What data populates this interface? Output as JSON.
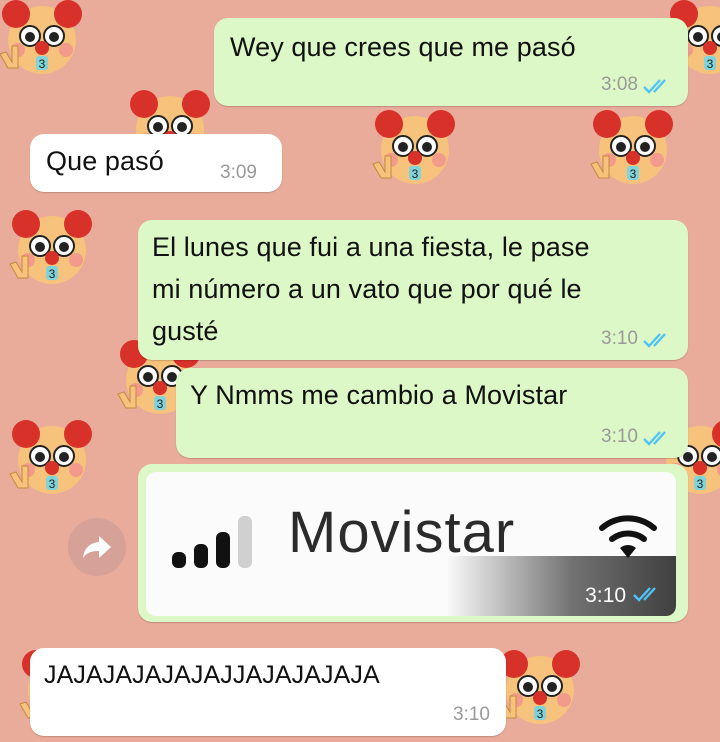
{
  "chat": {
    "wallpaper": {
      "background_color": "#e9ab9a",
      "pattern_icon": "crying-clown-emoji-icon"
    },
    "messages": [
      {
        "direction": "outgoing",
        "text": "Wey que crees que me pasó",
        "time": "3:08",
        "status": "read-double-check"
      },
      {
        "direction": "incoming",
        "text": "Que pasó",
        "time": "3:09"
      },
      {
        "direction": "outgoing",
        "lines": [
          "El lunes que fui a una fiesta, le pase",
          "mi número a un vato que por qué le",
          "gusté"
        ],
        "time": "3:10",
        "status": "read-double-check"
      },
      {
        "direction": "outgoing",
        "text": "Y Nmms me cambio a Movistar",
        "time": "3:10",
        "status": "read-double-check"
      },
      {
        "direction": "outgoing",
        "type": "image",
        "image_text": "Movistar",
        "image_icons": [
          "signal-bars-icon",
          "wifi-icon"
        ],
        "time": "3:10",
        "status": "read-double-check"
      },
      {
        "direction": "incoming",
        "text": "JAJAJAJAJAJAJJAJAJAJAJA",
        "time": "3:10"
      }
    ],
    "forward_button_icon": "forward-arrow-icon",
    "colors": {
      "outgoing_bubble": "#dcf8c6",
      "incoming_bubble": "#ffffff",
      "read_ticks": "#4fc3f7"
    }
  }
}
